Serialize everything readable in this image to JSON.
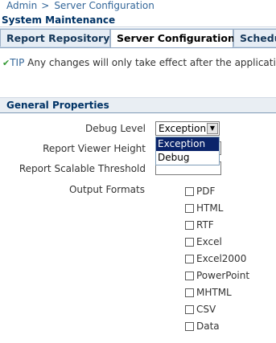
{
  "breadcrumb": {
    "items": [
      "Admin",
      "Server Configuration"
    ],
    "separator": ">"
  },
  "page_title": "System Maintenance",
  "tabs": [
    {
      "label": "Report Repository",
      "active": false
    },
    {
      "label": "Server Configuration",
      "active": true
    },
    {
      "label": "Schedu",
      "active": false
    }
  ],
  "tip": {
    "icon": "checkmark-icon",
    "label": "TIP",
    "text": "Any changes will only take effect after the application"
  },
  "section": {
    "title": "General Properties"
  },
  "form": {
    "debug_level": {
      "label": "Debug Level",
      "value": "Exception",
      "options": [
        "Exception",
        "Debug"
      ],
      "highlighted_option": "Exception",
      "open": true
    },
    "report_viewer_height": {
      "label": "Report Viewer Height",
      "value": ""
    },
    "report_scalable_threshold": {
      "label": "Report Scalable Threshold",
      "value": ""
    },
    "output_formats": {
      "label": "Output Formats",
      "options": [
        {
          "label": "PDF",
          "checked": false
        },
        {
          "label": "HTML",
          "checked": false
        },
        {
          "label": "RTF",
          "checked": false
        },
        {
          "label": "Excel",
          "checked": false
        },
        {
          "label": "Excel2000",
          "checked": false
        },
        {
          "label": "PowerPoint",
          "checked": false
        },
        {
          "label": "MHTML",
          "checked": false
        },
        {
          "label": "CSV",
          "checked": false
        },
        {
          "label": "Data",
          "checked": false
        }
      ]
    }
  },
  "colors": {
    "link": "#336699",
    "header_text": "#003366",
    "tab_bar": "#c8d7e8",
    "selected_option": "#0a246a",
    "tip_check": "#339933"
  }
}
